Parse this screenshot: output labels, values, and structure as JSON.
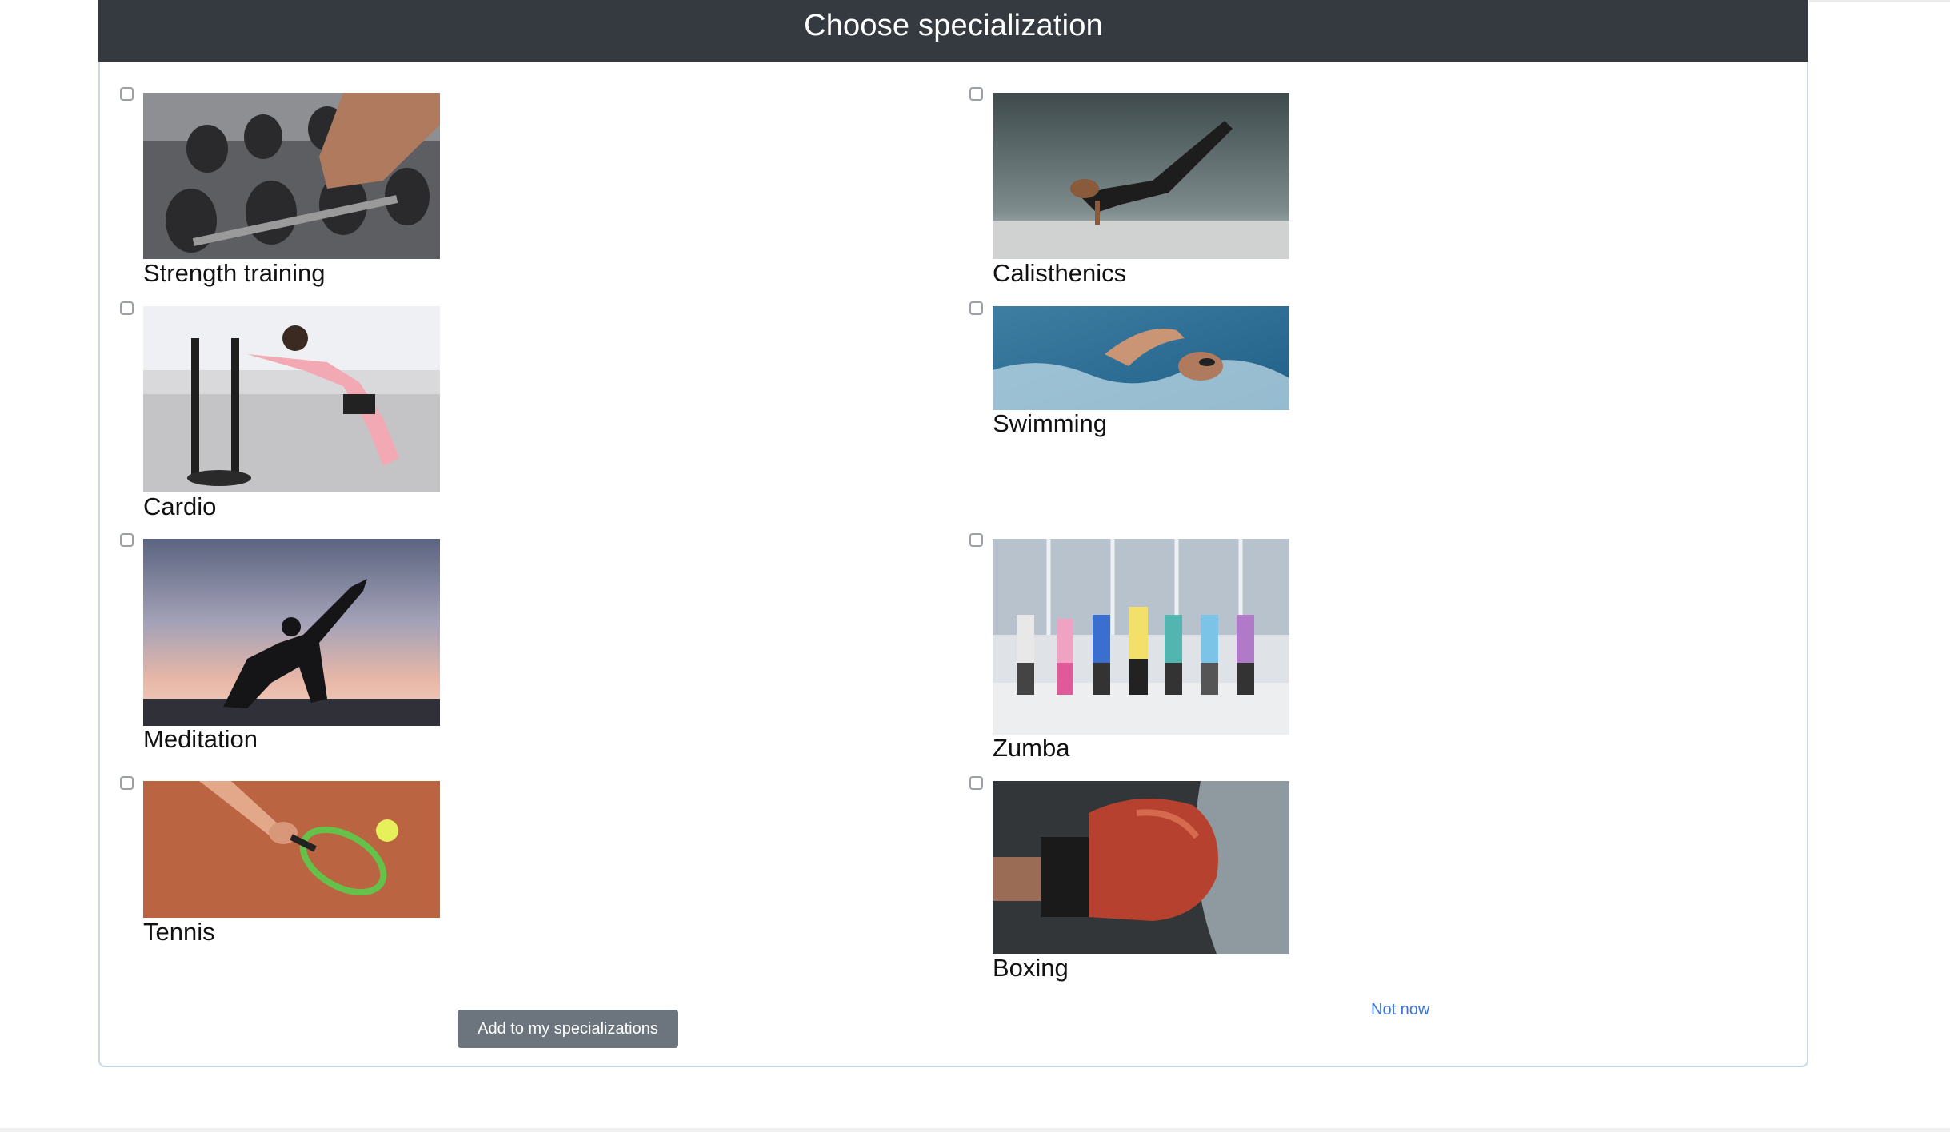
{
  "header": {
    "title": "Choose specialization"
  },
  "specializations": [
    {
      "label": "Strength training",
      "image": "dumbbells-photo"
    },
    {
      "label": "Calisthenics",
      "image": "calisthenics-photo"
    },
    {
      "label": "Cardio",
      "image": "sled-push-photo"
    },
    {
      "label": "Swimming",
      "image": "swimmer-photo"
    },
    {
      "label": "Meditation",
      "image": "yoga-sunset-photo"
    },
    {
      "label": "Zumba",
      "image": "dance-class-photo"
    },
    {
      "label": "Tennis",
      "image": "tennis-racket-photo"
    },
    {
      "label": "Boxing",
      "image": "boxing-glove-photo"
    }
  ],
  "actions": {
    "add_label": "Add to my specializations",
    "not_now_label": "Not now"
  },
  "colors": {
    "header_bg": "#343a40",
    "button_bg": "#6c757d",
    "link": "#3b74d8",
    "card_border": "#c9d6e8"
  }
}
